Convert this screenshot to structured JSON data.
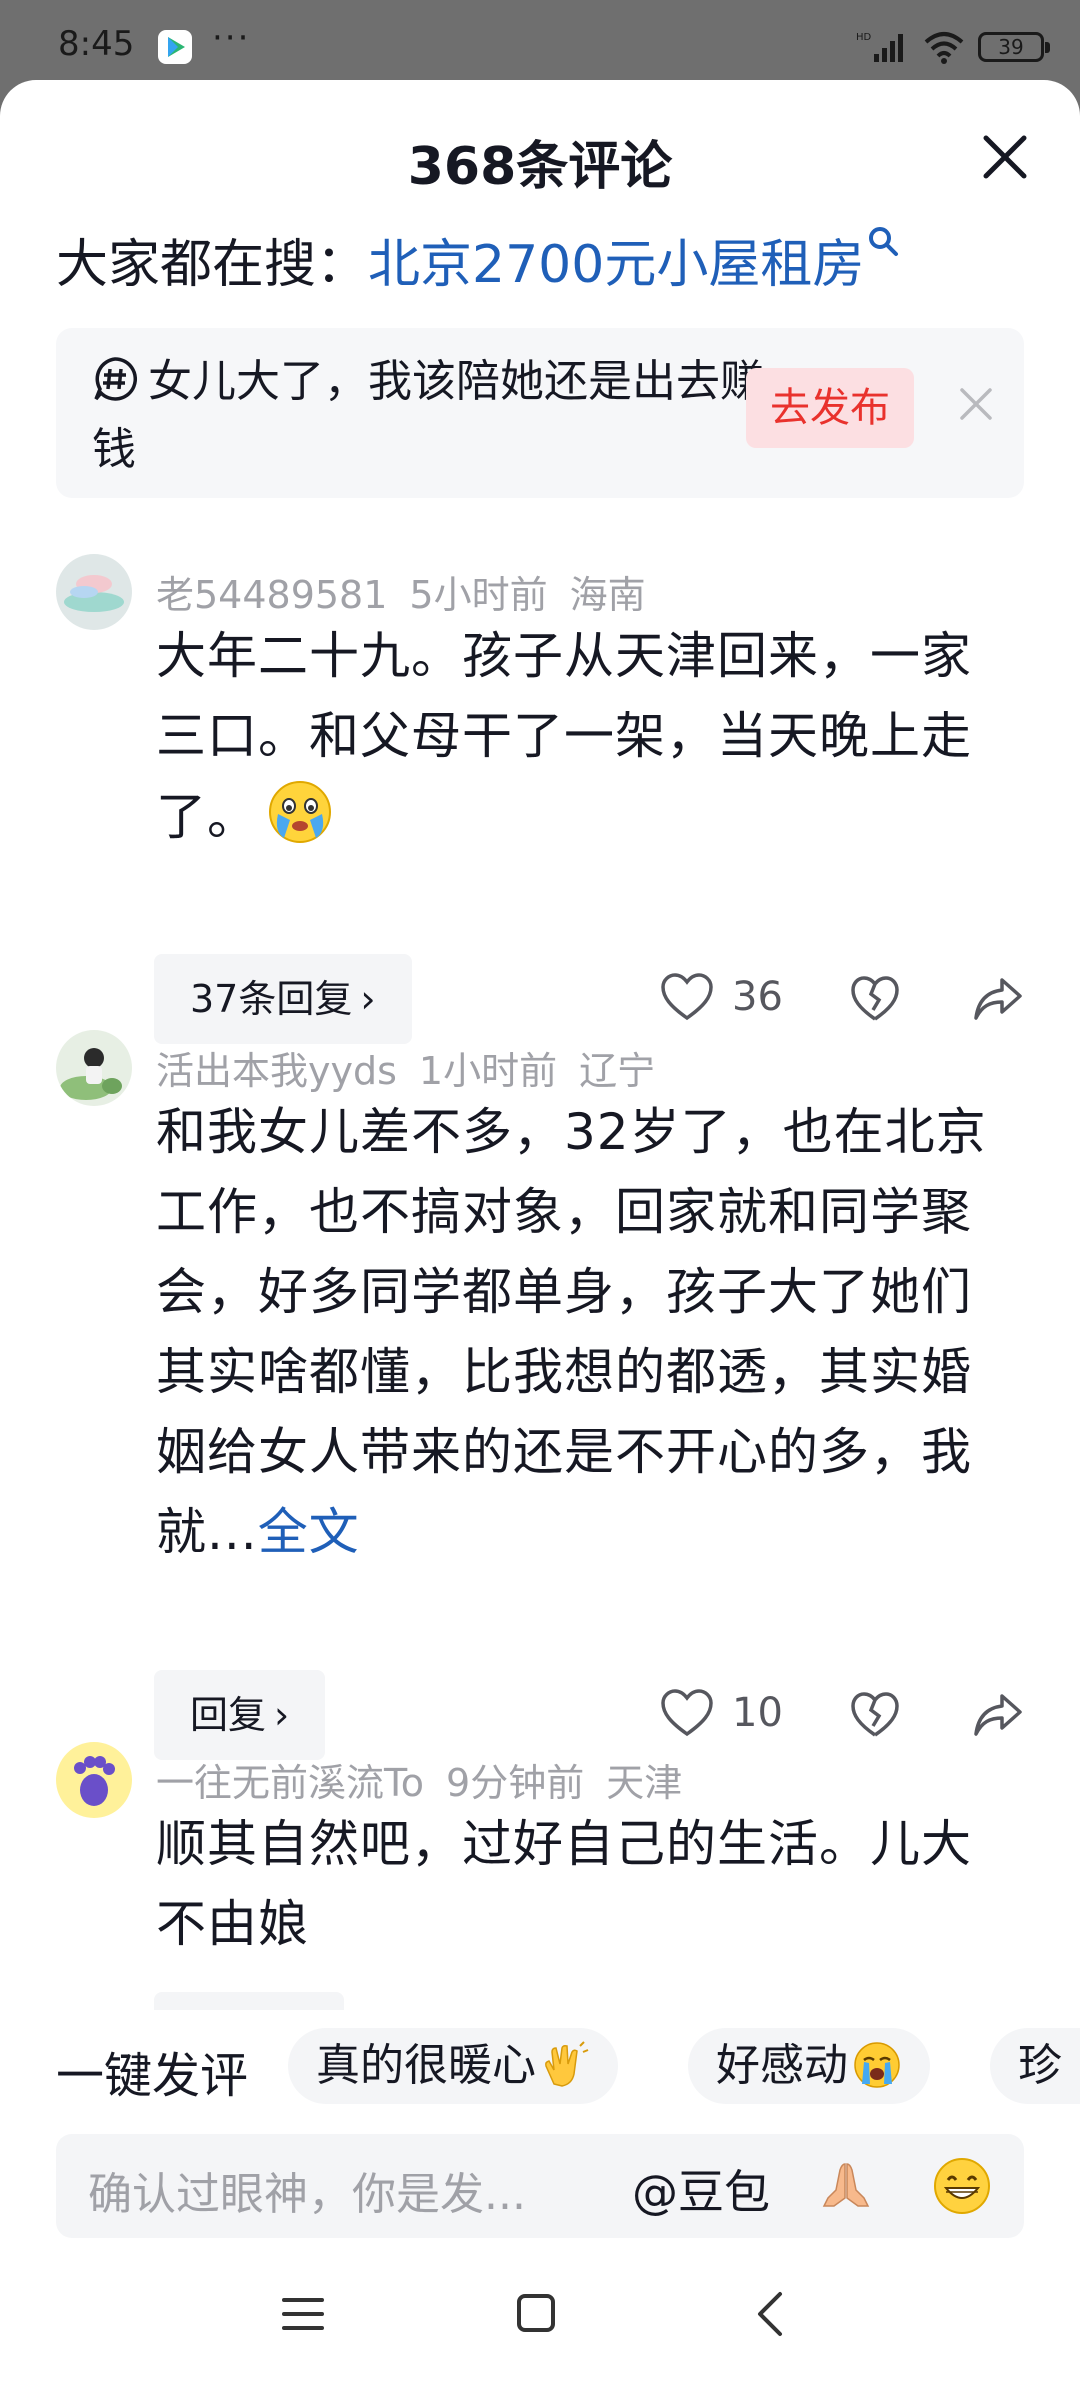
{
  "status_bar": {
    "time": "8:45",
    "more": "···",
    "network": "HD",
    "battery": "39"
  },
  "sheet": {
    "title": "368条评论",
    "close_icon": "close-icon"
  },
  "search": {
    "prefix": "大家都在搜：",
    "query": "北京2700元小屋租房",
    "icon": "search-icon"
  },
  "topic": {
    "text": "女儿大了，我该陪她还是出去赚钱",
    "publish_label": "去发布"
  },
  "comments": [
    {
      "user": "老54489581",
      "time": "5小时前",
      "location": "海南",
      "text": "大年二十九。孩子从天津回来，一家三口。和父母干了一架，当天晚上走了。",
      "emoji": "crying-face",
      "reply_label": "37条回复",
      "likes": "36"
    },
    {
      "user": "活出本我yyds",
      "time": "1小时前",
      "location": "辽宁",
      "text": "和我女儿差不多，32岁了，也在北京工作，也不搞对象，回家就和同学聚会，好多同学都单身，孩子大了她们其实啥都懂，比我想的都透，其实婚姻给女人带来的还是不开心的多，我就...",
      "full_link": "全文",
      "reply_label": "回复",
      "likes": "10"
    },
    {
      "user": "一往无前溪流To",
      "time": "9分钟前",
      "location": "天津",
      "text": "顺其自然吧，过好自己的生活。儿大不由娘"
    }
  ],
  "quick_comment": {
    "label": "一键发评",
    "chips": [
      {
        "text": "真的很暖心",
        "emoji": "clapping-hands"
      },
      {
        "text": "好感动",
        "emoji": "crying-face"
      },
      {
        "text": "珍",
        "emoji": ""
      }
    ]
  },
  "input": {
    "placeholder": "确认过眼神，你是发...",
    "mention": "@豆包",
    "icons": [
      "praying-hands",
      "grinning-face"
    ]
  },
  "colors": {
    "link": "#1f5fb8",
    "publish_text": "#e9322d",
    "publish_bg": "#fcdfe2",
    "meta_gray": "#a0a1a7"
  }
}
